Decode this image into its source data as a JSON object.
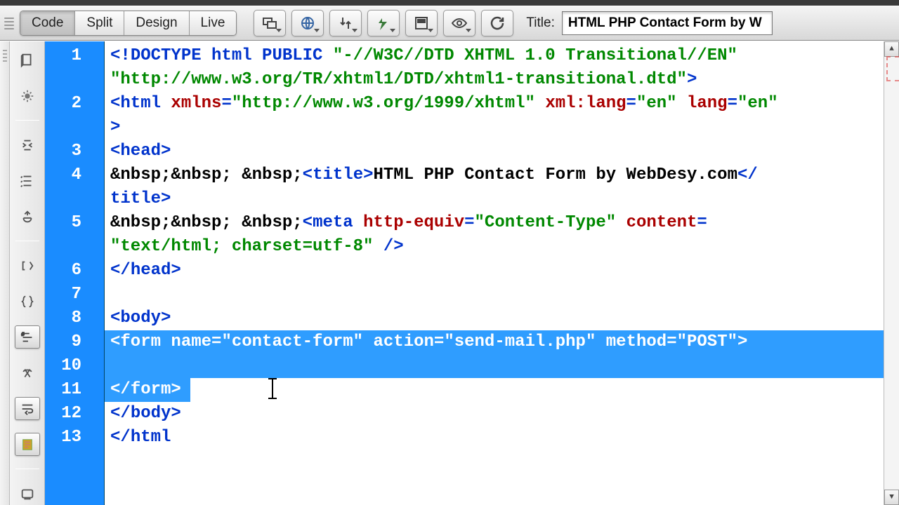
{
  "toolbar": {
    "views": {
      "code": "Code",
      "split": "Split",
      "design": "Design",
      "live": "Live"
    },
    "title_label": "Title:",
    "title_value": "HTML PHP Contact Form by W"
  },
  "code": {
    "l1a": "<!DOCTYPE html PUBLIC ",
    "l1b": "\"-//W3C//DTD XHTML 1.0 Transitional//EN\"",
    "l1c": "\"http://www.w3.org/TR/xhtml1/DTD/xhtml1-transitional.dtd\"",
    "l1d": ">",
    "l2_xmlns": "\"http://www.w3.org/1999/xhtml\"",
    "l2_xmllang": "\"en\"",
    "l2_lang": "\"en\"",
    "nbsp": "&nbsp;",
    "title_text": "HTML PHP Contact Form by WebDesy.com",
    "meta_equiv": "\"Content-Type\"",
    "meta_content": "\"text/html; charset=utf-8\"",
    "form_name": "\"contact-form\"",
    "form_action": "\"send-mail.php\"",
    "form_method": "\"POST\""
  },
  "line_numbers": [
    "1",
    "2",
    "3",
    "4",
    "5",
    "6",
    "7",
    "8",
    "9",
    "10",
    "11",
    "12",
    "13"
  ]
}
